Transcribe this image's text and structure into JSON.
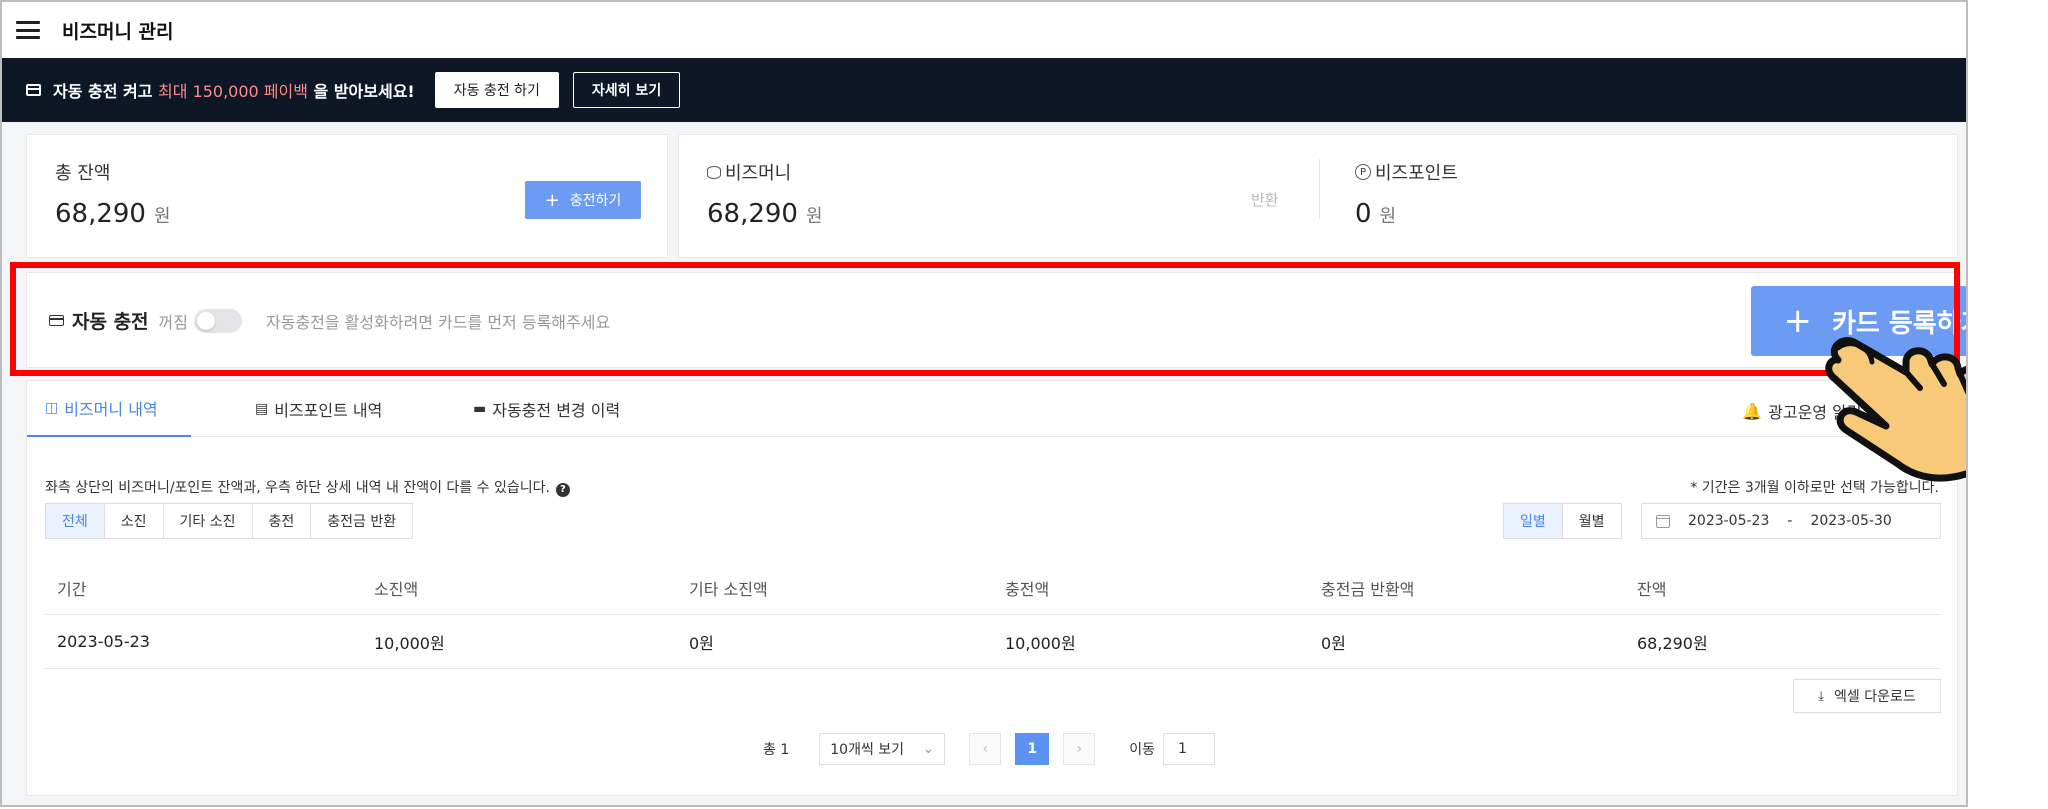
{
  "header": {
    "title": "비즈머니 관리"
  },
  "banner": {
    "text_prefix": "자동 충전 켜고 ",
    "text_highlight": "최대 150,000 페이백",
    "text_suffix": " 을 받아보세요!",
    "btn_auto": "자동 충전 하기",
    "btn_detail": "자세히 보기"
  },
  "balance": {
    "total_label": "총 잔액",
    "total_value": "68,290",
    "unit": "원",
    "charge_btn": "충전하기",
    "bizmoney_label": "비즈머니",
    "bizmoney_value": "68,290",
    "return_label": "반환",
    "bizpoint_label": "비즈포인트",
    "bizpoint_value": "0"
  },
  "auto_charge": {
    "title": "자동 충전",
    "state": "꺼짐",
    "hint": "자동충전을 활성화하려면 카드를 먼저 등록해주세요",
    "register_btn": "카드 등록하기"
  },
  "tabs": [
    {
      "label": "비즈머니 내역",
      "icon": "database-icon"
    },
    {
      "label": "비즈포인트 내역",
      "icon": "gift-icon"
    },
    {
      "label": "자동충전 변경 이력",
      "icon": "card-icon"
    }
  ],
  "alarm": {
    "label": "광고운영 알림",
    "state": "켜짐"
  },
  "notes": {
    "left": "좌측 상단의 비즈머니/포인트 잔액과, 우측 하단 상세 내역 내 잔액이 다를 수 있습니다.",
    "right": "* 기간은 3개월 이하로만 선택 가능합니다."
  },
  "filters": [
    "전체",
    "소진",
    "기타 소진",
    "충전",
    "충전금 반환"
  ],
  "period": [
    "일별",
    "월별"
  ],
  "date_range": {
    "start": "2023-05-23",
    "sep": "-",
    "end": "2023-05-30"
  },
  "table": {
    "columns": [
      "기간",
      "소진액",
      "기타 소진액",
      "충전액",
      "충전금 반환액",
      "잔액"
    ],
    "rows": [
      [
        "2023-05-23",
        "10,000원",
        "0원",
        "10,000원",
        "0원",
        "68,290원"
      ]
    ]
  },
  "excel_btn": "엑셀 다운로드",
  "pagination": {
    "total": "총 1",
    "page_size": "10개씩 보기",
    "current": "1",
    "move_label": "이동",
    "move_value": "1"
  },
  "colors": {
    "accent": "#6b9bf2",
    "banner_bg": "#0e1726",
    "highlight": "#ff0000"
  }
}
